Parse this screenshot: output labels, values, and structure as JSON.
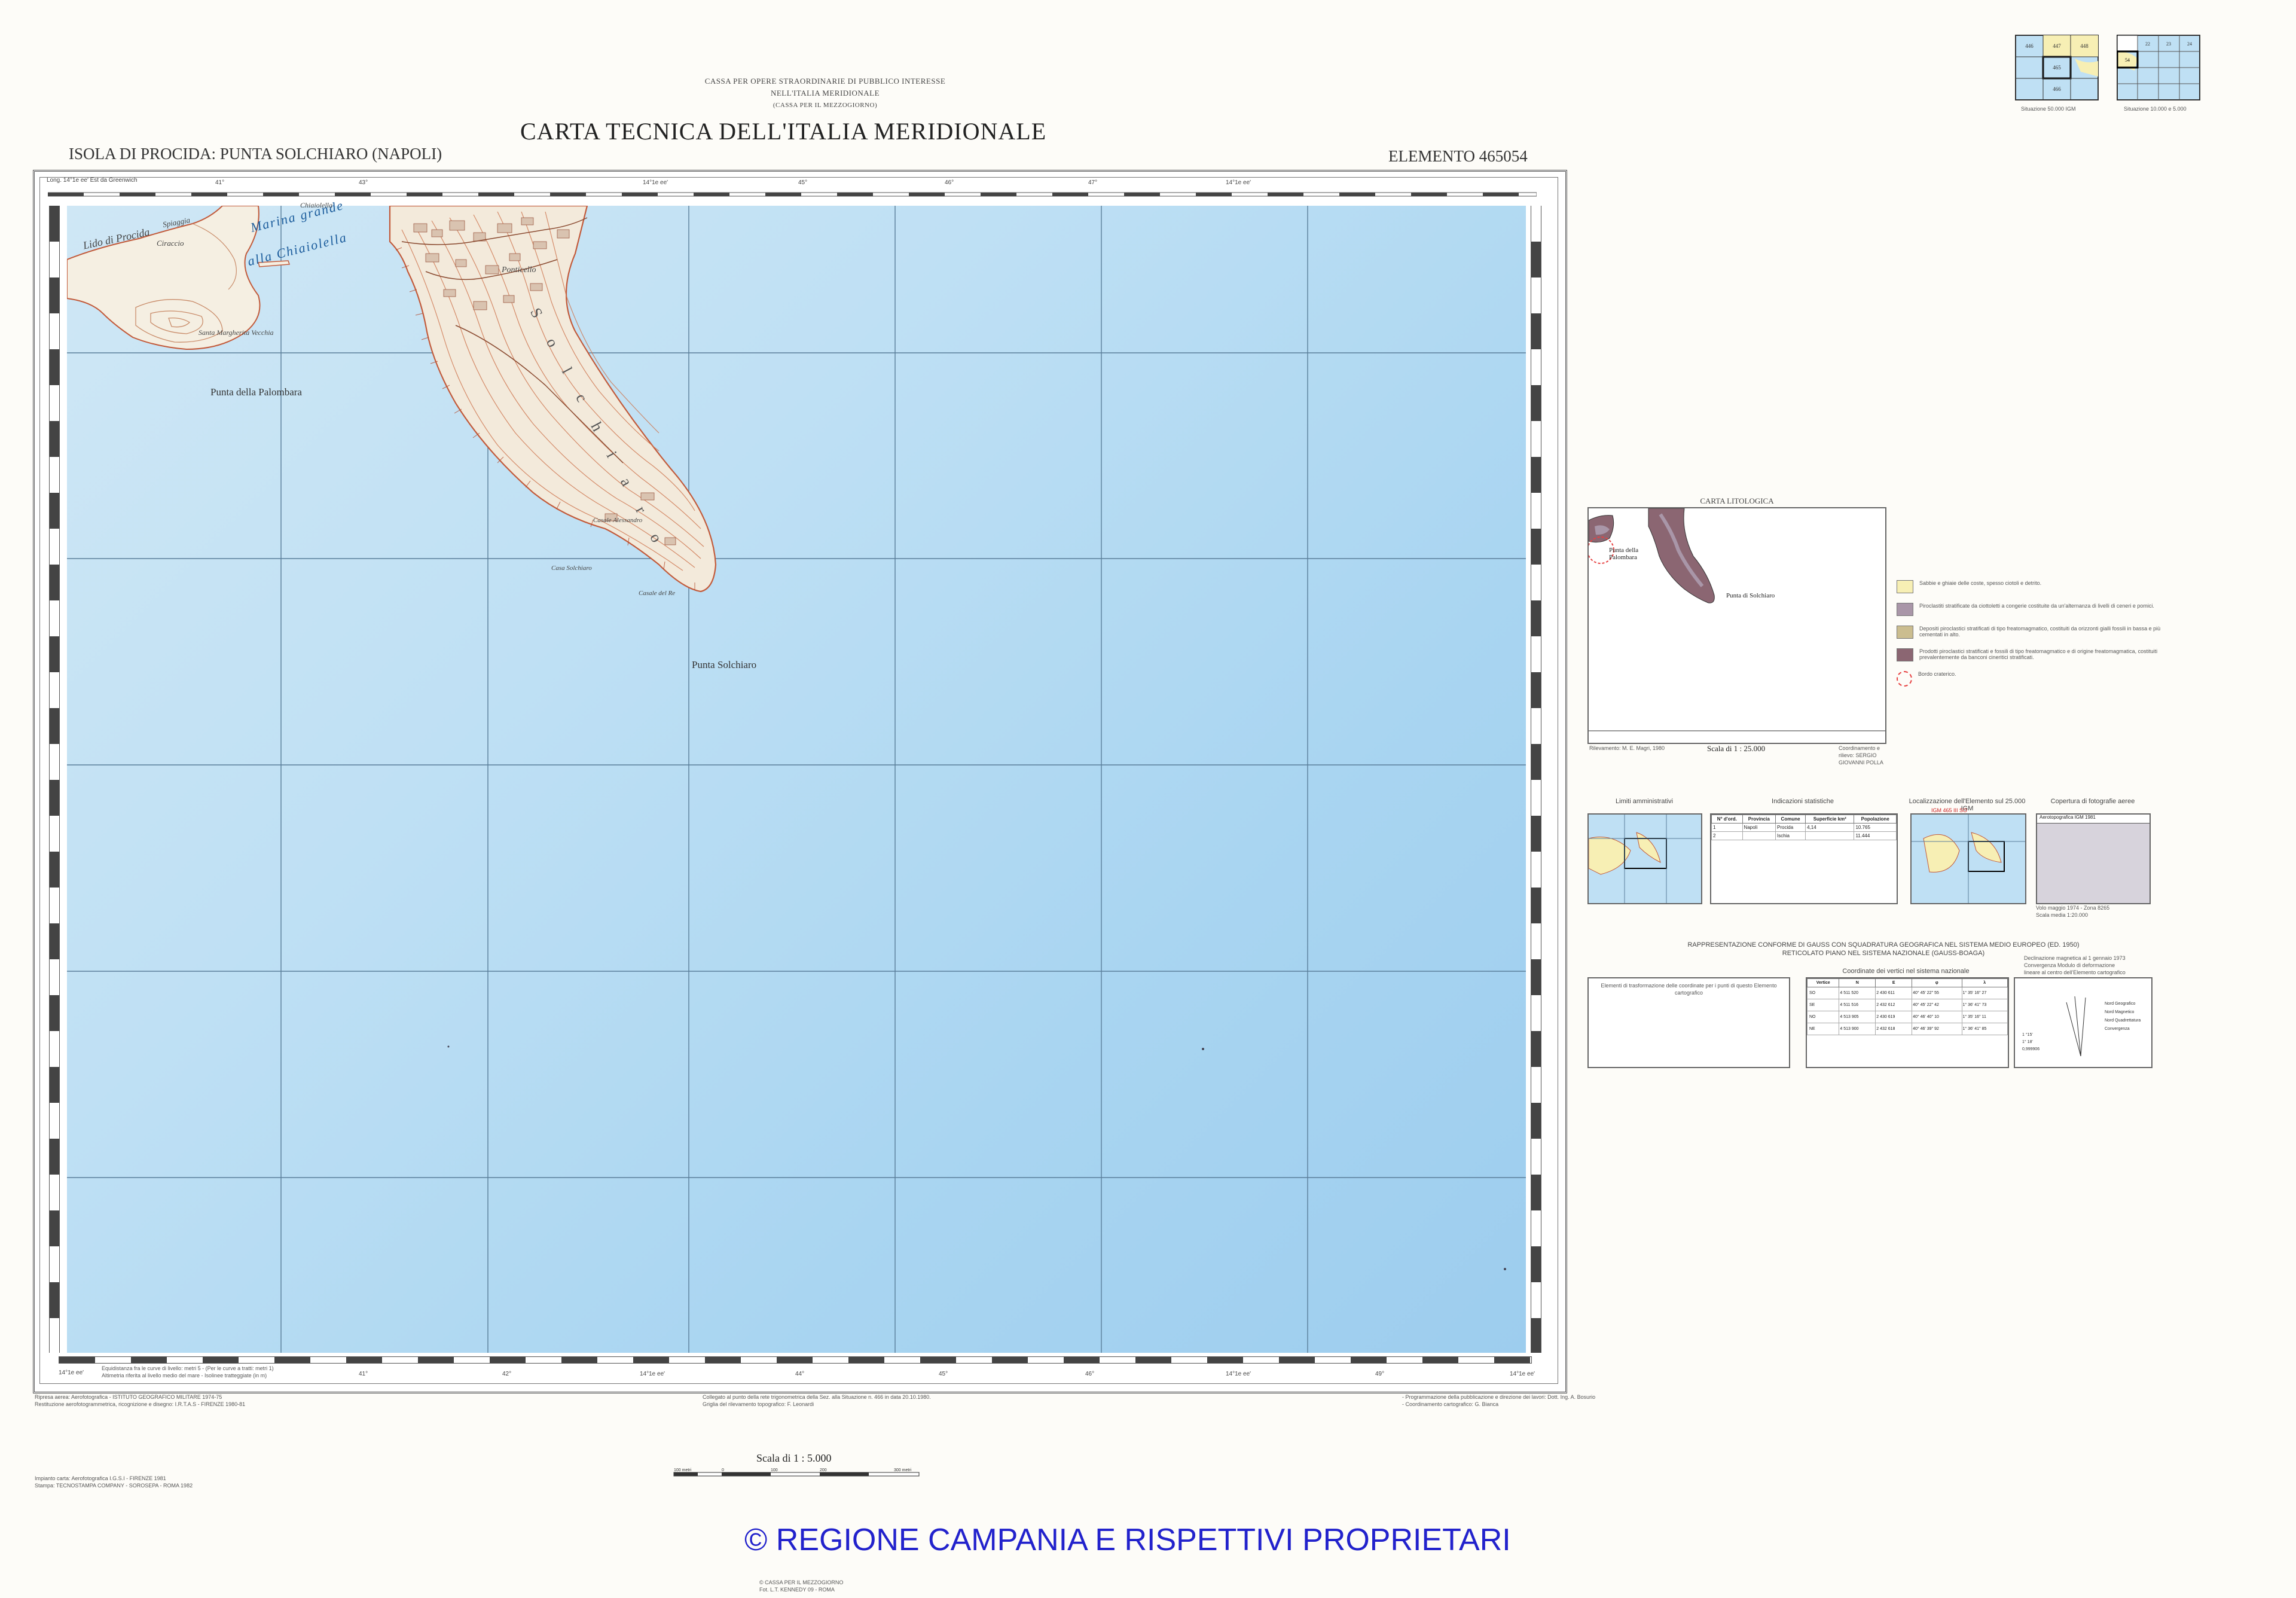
{
  "header": {
    "agency_line1": "CASSA PER OPERE STRAORDINARIE DI PUBBLICO INTERESSE",
    "agency_line2": "NELL'ITALIA MERIDIONALE",
    "agency_line3": "(CASSA PER IL MEZZOGIORNO)",
    "main_title": "CARTA TECNICA DELL'ITALIA MERIDIONALE",
    "sheet_name": "ISOLA DI PROCIDA: PUNTA SOLCHIARO (NAPOLI)",
    "element": "ELEMENTO  465054"
  },
  "index_maps": {
    "left_caption": "Situazione 50.000 IGM",
    "right_caption": "Situazione 10.000 e 5.000",
    "left_cells": [
      "446",
      "447",
      "448",
      "",
      "465",
      "",
      "",
      "",
      "466"
    ],
    "right_cells": [
      "22",
      "23",
      "24",
      "",
      "",
      "",
      "",
      "",
      "",
      "54",
      "",
      "",
      "",
      "",
      "",
      "",
      ""
    ],
    "right_highlight": "54"
  },
  "map": {
    "top_left_label": "Long.   14°1e ee'  Est da Greenwich",
    "top_lon_labels": [
      "14°1e ee'",
      "41°",
      "43°",
      "14°1e ee'",
      "45°",
      "46°",
      "47°",
      "14°1e ee'"
    ],
    "bottom_lon_labels": [
      "14°1e ee'",
      "41°",
      "42°",
      "14°1e ee'",
      "44°",
      "45°",
      "46°",
      "47°",
      "14°1e ee'",
      "49°",
      "14°1e ee'"
    ],
    "places": {
      "lido": "Lido di Procida",
      "spiaggia": "Spiaggia",
      "marina_grande": "Marina grande",
      "chiaiolella": "alla Chiaiolella",
      "ciraccio": "Ciraccio",
      "chiaiolella_town": "Chiaiolella",
      "santa_margherita": "Santa Margherita Vecchia",
      "palombara": "Punta della Palombara",
      "ponticello": "Ponticello",
      "solchiaro_ridge": "S o l c h i a r o",
      "solchiaro_point": "Punta Solchiaro",
      "casa1": "Casale Alessandro",
      "casa2": "Casa Solchiaro",
      "casa3": "Casale del Re"
    },
    "bottom_notes_left": "Equidistanza fra le curve di livello: metri 5 - (Per le curve a tratti: metri 1)\nAltimetria riferita al livello medio del mare - Isolinee tratteggiate (in m)",
    "bottom_notes_center": "Collegato al punto della rete trigonometrica della Sez. alla Situazione n. 466 in data 20.10.1980.\nGriglia del rilevamento topografico: F. Leonardi",
    "bottom_notes_right": "- Programmazione della pubblicazione e direzione dei lavori: Dott. Ing. A. Bosurio\n- Coordinamento cartografico: G. Bianca"
  },
  "footer": {
    "left_credits_1": "Ripresa aerea: Aerofotografica - ISTITUTO GEOGRAFICO MILITARE 1974-75",
    "left_credits_2": "Restituzione aerofotogrammetrica, ricognizione e disegno: I.R.T.A.S - FIRENZE 1980-81",
    "left_credits_3": "Impianto carta: Aerofotografica I.G.S.I - FIRENZE 1981",
    "left_credits_4": "Stampa: TECNOSTAMPA COMPANY - SOROSEPA - ROMA 1982",
    "scale_label": "Scala di 1 : 5.000",
    "scale_ticks": [
      "100 metri",
      "0",
      "100",
      "200",
      "300 metri"
    ],
    "copyright": "© REGIONE CAMPANIA E RISPETTIVI PROPRIETARI",
    "printer_line1": "© CASSA PER IL MEZZOGIORNO",
    "printer_line2": "Fot. L.T. KENNEDY 09 - ROMA"
  },
  "litologica": {
    "title": "CARTA LITOLOGICA",
    "place1": "Punta della Palombara",
    "place2": "Punta di Solchiaro",
    "scale": "Scala di 1 : 25.000",
    "note_left": "Rilevamento: M. E. Magri, 1980",
    "note_right": "Coordinamento e rilievo: SERGIO GIOVANNI POLLA",
    "legend": [
      {
        "color": "#f7efb4",
        "text": "Sabbie e ghiaie delle coste, spesso ciotoli e detrito."
      },
      {
        "color": "#a996a8",
        "text": "Piroclastiti stratificate da ciottoletti a congerie costituite da un'alternanza di livelli di ceneri e pomici."
      },
      {
        "color": "#cbbd8f",
        "text": "Depositi piroclastici stratificati di tipo freatomagmatico, costituiti da orizzonti gialli fossili in bassa e più cementati in alto."
      },
      {
        "color": "#8b6672",
        "text": "Prodotti piroclastici stratificati e fossili di tipo freatomagmatico e di origine freatomagmatica, costituiti prevalentemente da banconi cineritici stratificati."
      },
      {
        "color": "#e74242",
        "text": "Bordo craterico."
      }
    ]
  },
  "info_panels": {
    "limiti_title": "Limiti amministrativi",
    "indic_title": "Indicazioni statistiche",
    "local_title": "Localizzazione dell'Elemento sul 25.000 IGM",
    "local_sub": "IGM 465 III SO",
    "copertura_title": "Copertura di fotografie aeree",
    "copertura_sub": "Aerotopografica IGM 1981",
    "indic_headers": [
      "N° d'ord.",
      "Provincia",
      "Comune",
      "Superficie km²",
      "Popolazione"
    ],
    "indic_rows": [
      [
        "1",
        "Napoli",
        "Procida",
        "4,14",
        "10.765"
      ],
      [
        "2",
        "",
        "Ischia",
        "",
        "11.444"
      ]
    ],
    "copertura_note": "Volo maggio 1974 - Zona 8265\nScala media 1:20.000"
  },
  "projection": {
    "title1": "RAPPRESENTAZIONE CONFORME DI GAUSS CON SQUADRATURA GEOGRAFICA NEL SISTEMA MEDIO EUROPEO (ED. 1950)",
    "title2": "RETICOLATO PIANO NEL SISTEMA NAZIONALE (GAUSS-BOAGA)",
    "declin_title": "Declinazione magnetica al 1 gennaio 1973\nConvergenza  Modulo di deformazione\nlineare al centro dell'Elemento cartografico",
    "trasf_title": "Elementi di trasformazione delle coordinate per i punti di questo Elemento cartografico",
    "coord_title": "Coordinate dei vertici nel sistema nazionale",
    "coord_headers": [
      "Vertice",
      "N",
      "E",
      "φ",
      "λ"
    ],
    "coord_rows": [
      [
        "SO",
        "4 511 520",
        "2 430 611",
        "40° 45' 22'' 55",
        "1° 35' 16'' 27"
      ],
      [
        "SE",
        "4 511 516",
        "2 432 612",
        "40° 45' 22'' 42",
        "1° 36' 41'' 73"
      ],
      [
        "NO",
        "4 513 905",
        "2 430 619",
        "40° 46' 40'' 10",
        "1° 35' 16'' 11"
      ],
      [
        "NE",
        "4 513 900",
        "2 432 618",
        "40° 46' 39'' 92",
        "1° 36' 41'' 85"
      ]
    ],
    "declin_labels": [
      "N",
      "Nord Geografico",
      "Nord Magnetico",
      "Nord Quadrettatura",
      "Convergenza"
    ],
    "declin_values": [
      "1 °15'",
      "1° 18'",
      "0,999906"
    ]
  }
}
